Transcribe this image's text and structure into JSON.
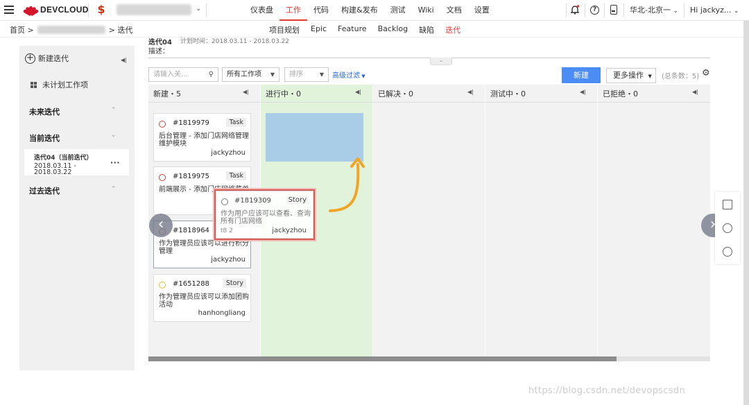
{
  "topbar": {
    "brand": "DEVCLOUD",
    "project_icon": "$",
    "nav": [
      "仪表盘",
      "工作",
      "代码",
      "构建&发布",
      "测试",
      "Wiki",
      "文档",
      "设置"
    ],
    "active_nav": "工作",
    "region": "华北-北京一",
    "user": "Hi jackyz..."
  },
  "subbar": {
    "breadcrumb": [
      "首页",
      "迭代"
    ],
    "tabs": [
      "项目规划",
      "Epic",
      "Feature",
      "Backlog",
      "缺陷",
      "迭代"
    ],
    "active_tab": "迭代"
  },
  "sidebar": {
    "new_iteration": "新建迭代",
    "unplanned": "未计划工作项",
    "future": "未来迭代",
    "current": "当前迭代",
    "current_item": {
      "name": "迭代04（当前迭代）",
      "dates": "2018.03.11 - 2018.03.22"
    },
    "past": "过去迭代"
  },
  "header": {
    "iteration_title": "迭代04",
    "plan_time": "计划时间：2018.03.11 - 2018.03.22",
    "description_label": "描述："
  },
  "filters": {
    "search_placeholder": "请输入关...",
    "type_select": "所有工作项",
    "sort_placeholder": "排序",
    "advanced": "高级过滤",
    "new_button": "新建",
    "more_button": "更多操作",
    "total": "(总条数：5)"
  },
  "columns": [
    {
      "title": "新建・5"
    },
    {
      "title": "进行中・0"
    },
    {
      "title": "已解决・0"
    },
    {
      "title": "测试中・0"
    },
    {
      "title": "已拒绝・0"
    }
  ],
  "cards": [
    {
      "id": "#1819979",
      "type": "Task",
      "title": "后台管理 - 添加门店网络管理维护模块",
      "owner": "jackyzhou",
      "status_color": "#d04040"
    },
    {
      "id": "#1819975",
      "type": "Task",
      "title": "前端展示 - 添加门店网络菜单",
      "owner": "",
      "status_color": "#d04040"
    },
    {
      "id": "#1818964",
      "type": "",
      "title": "作为管理员应该可以进行积分管理",
      "owner": "jackyzhou",
      "status_color": "#d04040"
    },
    {
      "id": "#1651288",
      "type": "Story",
      "title": "作为管理员应该可以添加团购活动",
      "owner": "hanhongliang",
      "status_color": "#e0c830"
    }
  ],
  "dragging_card": {
    "id": "#1819309",
    "type": "Story",
    "title": "作为用户应该可以查看、查询所有门店网络",
    "extra": "t8 2",
    "owner": "jackyzhou"
  },
  "watermark": "https://blog.csdn.net/devopscsdn",
  "colors": {
    "accent": "#e53935",
    "primary_button": "#4c8cf5",
    "drop_zone": "#a9cde6",
    "target_column": "#e2f3dc",
    "arrow": "#f0a526"
  }
}
